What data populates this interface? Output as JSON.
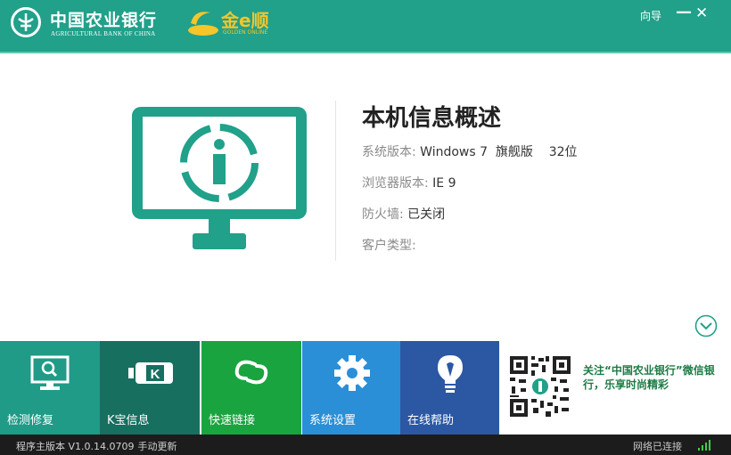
{
  "header": {
    "bank_name_cn": "中国农业银行",
    "bank_name_en": "AGRICULTURAL BANK OF CHINA",
    "brand_cn": "金e顺",
    "brand_en": "GOLDEN ONLINE",
    "guide_label": "向导",
    "minimize_icon": "minimize-icon",
    "close_icon": "close-icon"
  },
  "info": {
    "title": "本机信息概述",
    "rows": [
      {
        "key": "系统版本: ",
        "value": "Windows 7  旗舰版    32位"
      },
      {
        "key": "浏览器版本: ",
        "value": "IE 9"
      },
      {
        "key": "防火墙: ",
        "value": "已关闭"
      },
      {
        "key": "客户类型: ",
        "value": ""
      }
    ]
  },
  "tiles": [
    {
      "label": "检测修复",
      "icon": "monitor-search-icon",
      "color": "#1f9b87"
    },
    {
      "label": "K宝信息",
      "icon": "usb-key-icon",
      "color": "#176f60"
    },
    {
      "label": "快速链接",
      "icon": "link-icon",
      "color": "#1aa43f"
    },
    {
      "label": "系统设置",
      "icon": "gear-icon",
      "color": "#2a8fd6"
    },
    {
      "label": "在线帮助",
      "icon": "lightbulb-icon",
      "color": "#2c58a3"
    }
  ],
  "promo": {
    "text": "关注“中国农业银行”微信银行，乐享时尚精彩"
  },
  "status": {
    "version": "程序主版本 V1.0.14.0709",
    "update_label": "手动更新",
    "network": "网络已连接"
  },
  "colors": {
    "brand_green": "#21a08a",
    "gold": "#f5c52a"
  }
}
